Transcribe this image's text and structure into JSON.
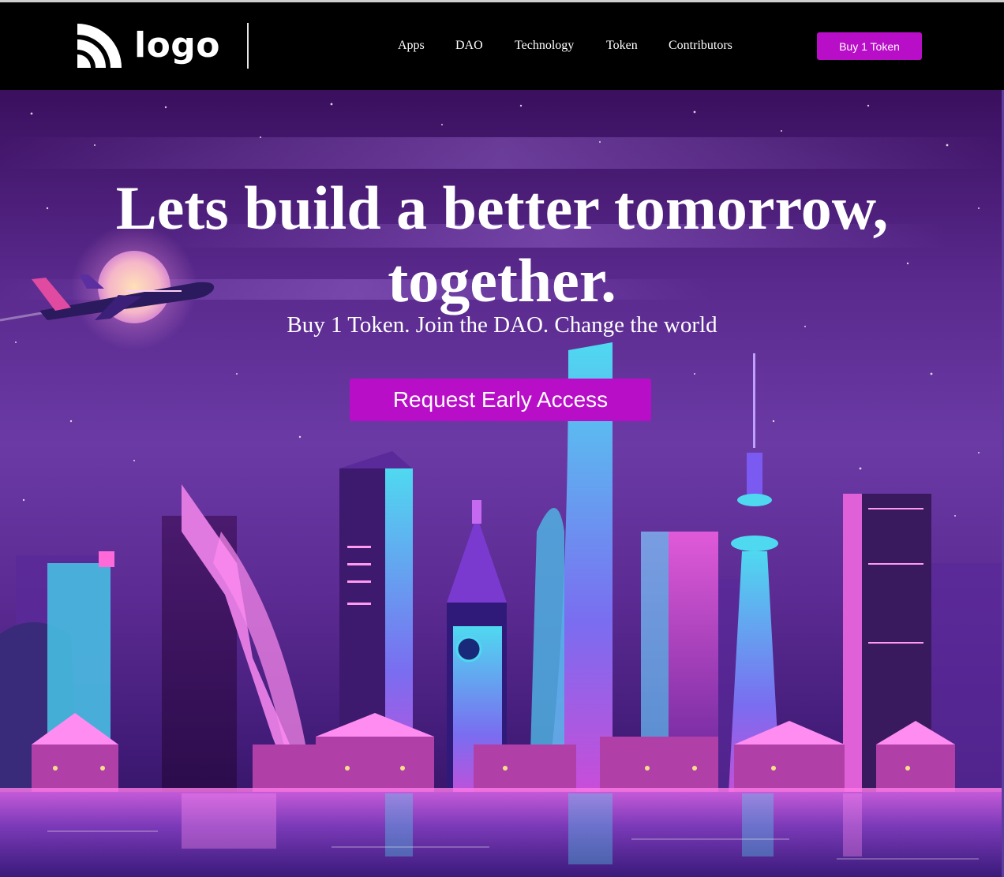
{
  "brand": {
    "logo_text": "logo"
  },
  "nav": {
    "items": [
      {
        "label": "Apps"
      },
      {
        "label": "DAO"
      },
      {
        "label": "Technology"
      },
      {
        "label": "Token"
      },
      {
        "label": "Contributors"
      }
    ],
    "buy_label": "Buy 1 Token"
  },
  "hero": {
    "headline_line1": "Lets build a better tomorrow,",
    "headline_line2": "together.",
    "subline": "Buy 1 Token. Join the DAO. Change the world",
    "cta_label": "Request Early Access",
    "illustration": "neon-night-city-skyline"
  },
  "colors": {
    "header_bg": "#000000",
    "accent": "#b90ec8",
    "hero_sky_top": "#3a0f5e",
    "hero_sky_mid": "#6b3aa5",
    "text": "#ffffff"
  }
}
